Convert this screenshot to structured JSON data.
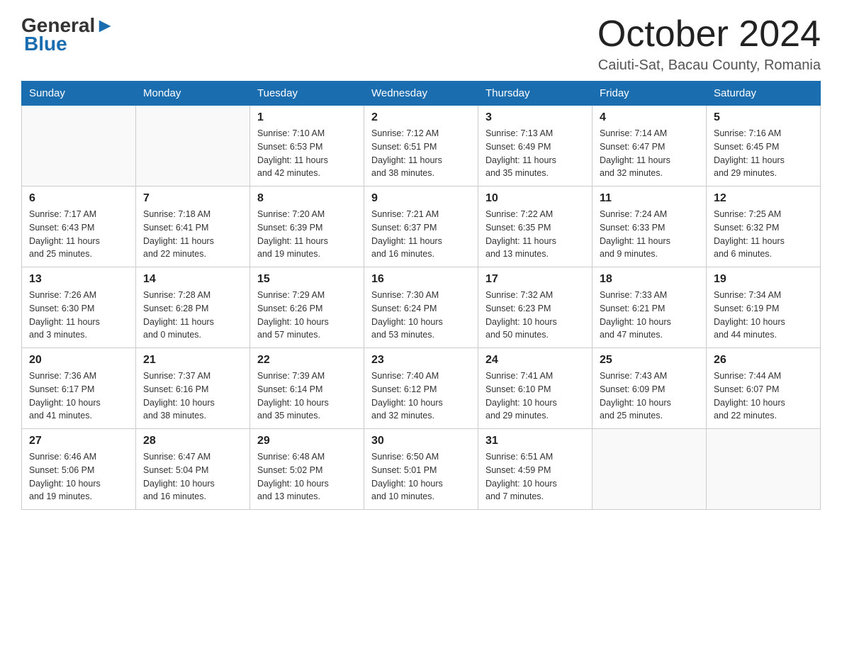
{
  "logo": {
    "general": "General",
    "blue": "Blue",
    "arrow_color": "#1a6daf"
  },
  "header": {
    "title": "October 2024",
    "location": "Caiuti-Sat, Bacau County, Romania"
  },
  "weekdays": [
    "Sunday",
    "Monday",
    "Tuesday",
    "Wednesday",
    "Thursday",
    "Friday",
    "Saturday"
  ],
  "weeks": [
    [
      {
        "day": "",
        "info": ""
      },
      {
        "day": "",
        "info": ""
      },
      {
        "day": "1",
        "info": "Sunrise: 7:10 AM\nSunset: 6:53 PM\nDaylight: 11 hours\nand 42 minutes."
      },
      {
        "day": "2",
        "info": "Sunrise: 7:12 AM\nSunset: 6:51 PM\nDaylight: 11 hours\nand 38 minutes."
      },
      {
        "day": "3",
        "info": "Sunrise: 7:13 AM\nSunset: 6:49 PM\nDaylight: 11 hours\nand 35 minutes."
      },
      {
        "day": "4",
        "info": "Sunrise: 7:14 AM\nSunset: 6:47 PM\nDaylight: 11 hours\nand 32 minutes."
      },
      {
        "day": "5",
        "info": "Sunrise: 7:16 AM\nSunset: 6:45 PM\nDaylight: 11 hours\nand 29 minutes."
      }
    ],
    [
      {
        "day": "6",
        "info": "Sunrise: 7:17 AM\nSunset: 6:43 PM\nDaylight: 11 hours\nand 25 minutes."
      },
      {
        "day": "7",
        "info": "Sunrise: 7:18 AM\nSunset: 6:41 PM\nDaylight: 11 hours\nand 22 minutes."
      },
      {
        "day": "8",
        "info": "Sunrise: 7:20 AM\nSunset: 6:39 PM\nDaylight: 11 hours\nand 19 minutes."
      },
      {
        "day": "9",
        "info": "Sunrise: 7:21 AM\nSunset: 6:37 PM\nDaylight: 11 hours\nand 16 minutes."
      },
      {
        "day": "10",
        "info": "Sunrise: 7:22 AM\nSunset: 6:35 PM\nDaylight: 11 hours\nand 13 minutes."
      },
      {
        "day": "11",
        "info": "Sunrise: 7:24 AM\nSunset: 6:33 PM\nDaylight: 11 hours\nand 9 minutes."
      },
      {
        "day": "12",
        "info": "Sunrise: 7:25 AM\nSunset: 6:32 PM\nDaylight: 11 hours\nand 6 minutes."
      }
    ],
    [
      {
        "day": "13",
        "info": "Sunrise: 7:26 AM\nSunset: 6:30 PM\nDaylight: 11 hours\nand 3 minutes."
      },
      {
        "day": "14",
        "info": "Sunrise: 7:28 AM\nSunset: 6:28 PM\nDaylight: 11 hours\nand 0 minutes."
      },
      {
        "day": "15",
        "info": "Sunrise: 7:29 AM\nSunset: 6:26 PM\nDaylight: 10 hours\nand 57 minutes."
      },
      {
        "day": "16",
        "info": "Sunrise: 7:30 AM\nSunset: 6:24 PM\nDaylight: 10 hours\nand 53 minutes."
      },
      {
        "day": "17",
        "info": "Sunrise: 7:32 AM\nSunset: 6:23 PM\nDaylight: 10 hours\nand 50 minutes."
      },
      {
        "day": "18",
        "info": "Sunrise: 7:33 AM\nSunset: 6:21 PM\nDaylight: 10 hours\nand 47 minutes."
      },
      {
        "day": "19",
        "info": "Sunrise: 7:34 AM\nSunset: 6:19 PM\nDaylight: 10 hours\nand 44 minutes."
      }
    ],
    [
      {
        "day": "20",
        "info": "Sunrise: 7:36 AM\nSunset: 6:17 PM\nDaylight: 10 hours\nand 41 minutes."
      },
      {
        "day": "21",
        "info": "Sunrise: 7:37 AM\nSunset: 6:16 PM\nDaylight: 10 hours\nand 38 minutes."
      },
      {
        "day": "22",
        "info": "Sunrise: 7:39 AM\nSunset: 6:14 PM\nDaylight: 10 hours\nand 35 minutes."
      },
      {
        "day": "23",
        "info": "Sunrise: 7:40 AM\nSunset: 6:12 PM\nDaylight: 10 hours\nand 32 minutes."
      },
      {
        "day": "24",
        "info": "Sunrise: 7:41 AM\nSunset: 6:10 PM\nDaylight: 10 hours\nand 29 minutes."
      },
      {
        "day": "25",
        "info": "Sunrise: 7:43 AM\nSunset: 6:09 PM\nDaylight: 10 hours\nand 25 minutes."
      },
      {
        "day": "26",
        "info": "Sunrise: 7:44 AM\nSunset: 6:07 PM\nDaylight: 10 hours\nand 22 minutes."
      }
    ],
    [
      {
        "day": "27",
        "info": "Sunrise: 6:46 AM\nSunset: 5:06 PM\nDaylight: 10 hours\nand 19 minutes."
      },
      {
        "day": "28",
        "info": "Sunrise: 6:47 AM\nSunset: 5:04 PM\nDaylight: 10 hours\nand 16 minutes."
      },
      {
        "day": "29",
        "info": "Sunrise: 6:48 AM\nSunset: 5:02 PM\nDaylight: 10 hours\nand 13 minutes."
      },
      {
        "day": "30",
        "info": "Sunrise: 6:50 AM\nSunset: 5:01 PM\nDaylight: 10 hours\nand 10 minutes."
      },
      {
        "day": "31",
        "info": "Sunrise: 6:51 AM\nSunset: 4:59 PM\nDaylight: 10 hours\nand 7 minutes."
      },
      {
        "day": "",
        "info": ""
      },
      {
        "day": "",
        "info": ""
      }
    ]
  ]
}
